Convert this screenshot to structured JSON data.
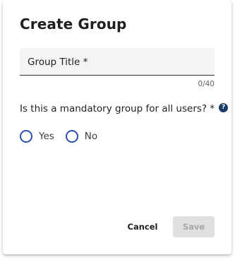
{
  "dialog": {
    "title": "Create Group",
    "group_title_field": {
      "label": "Group Title *",
      "value": "",
      "counter": "0/40"
    },
    "mandatory_question": {
      "text": "Is this a mandatory group for all users? *",
      "help_icon": "help-circle-icon",
      "help_glyph": "?",
      "options": [
        {
          "label": "Yes",
          "selected": false
        },
        {
          "label": "No",
          "selected": false
        }
      ]
    },
    "actions": {
      "cancel_label": "Cancel",
      "save_label": "Save",
      "save_enabled": false
    }
  },
  "colors": {
    "radio_accent": "#2f4fae",
    "help_icon_bg": "#1a3a6b",
    "field_bg": "#f4f4f4",
    "disabled_button_bg": "#e0e0e0"
  }
}
